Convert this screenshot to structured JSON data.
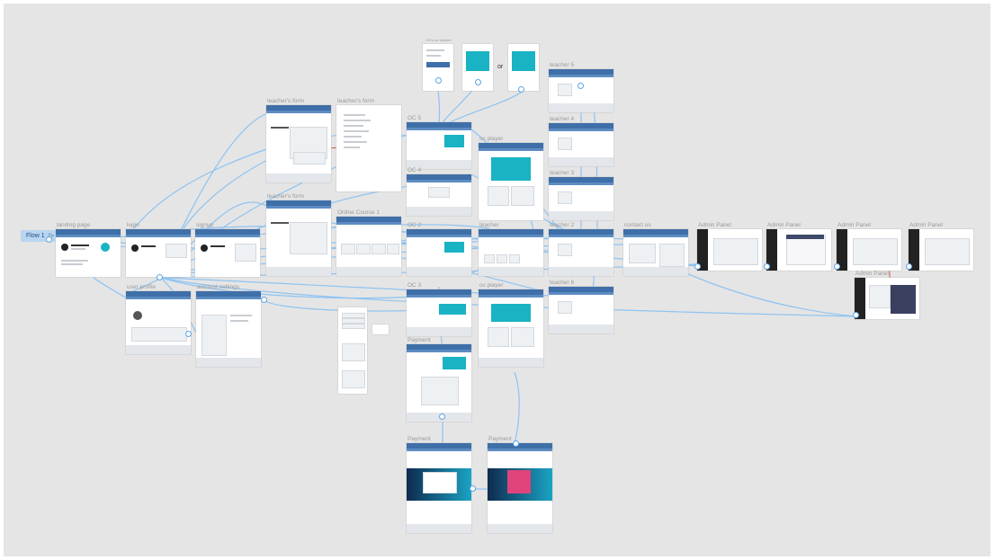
{
  "flow_start": {
    "label": "Flow 1",
    "icon": "play-icon"
  },
  "wire_color": "#8ec3f1",
  "frames": {
    "landing_page": "landing page",
    "login": "login",
    "signup": "signup",
    "user_profile": "user profile",
    "account_settings": "account settings",
    "teachers_form_1": "teacher's form",
    "teachers_form_2": "teacher's form",
    "teachers_form_3": "teacher's form",
    "online_course_1": "Online Course 1",
    "oc_5": "OC 5",
    "oc_4": "OC 4",
    "oc_2": "OC 2",
    "oc_3": "OC 3",
    "oc_player_1": "oc player",
    "oc_player_2": "oc player",
    "teacher": "teacher",
    "teacher_5": "teacher 5",
    "teacher_4": "teacher 4",
    "teacher_3": "teacher 3",
    "teacher_2": "teacher 2",
    "teacher_6": "teacher 6",
    "contact_us": "contact us",
    "payment_1": "Payment",
    "payment_2": "Payment",
    "payment_3": "Payment",
    "admin_panel_1": "Admin Panel",
    "admin_panel_2": "Admin Panel",
    "admin_panel_3": "Admin Panel",
    "admin_panel_4": "Admin Panel",
    "admin_panel_5": "Admin Panel",
    "mobile_label": "If it's on sleeper",
    "or_label": "or"
  }
}
